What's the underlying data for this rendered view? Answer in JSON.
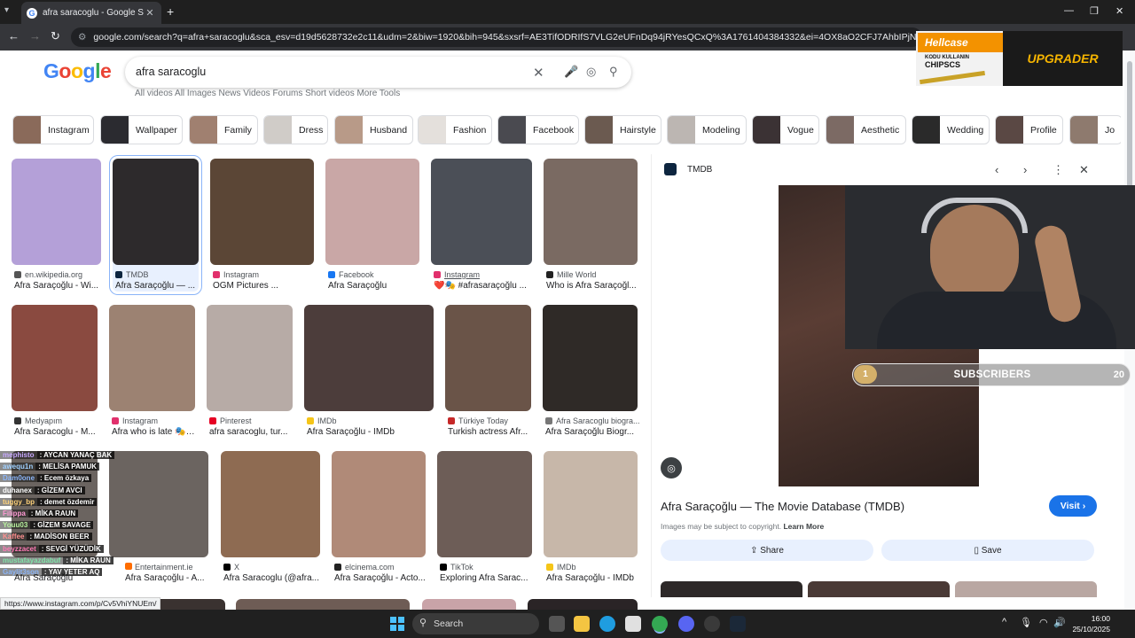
{
  "browser": {
    "tab_title": "afra saracoglu - Google Search",
    "url": "google.com/search?q=afra+saracoglu&sca_esv=d19d5628732e2c11&udm=2&biw=1920&bih=945&sxsrf=AE3TifODRIfS7VLG2eUFnDq94jRYesQCxQ%3A1761404384332&ei=4OX8aO2CFJ7AhbIPjNrtwQw&ved=0ahUKEwjt8ojVz"
  },
  "google": {
    "logo": "Google",
    "query": "afra saracoglu",
    "search_tabs_partial": "All videos   All   Images   News   Videos   Forums   Short videos   More                                                                   Tools"
  },
  "chips": [
    {
      "label": "Instagram"
    },
    {
      "label": "Wallpaper"
    },
    {
      "label": "Family"
    },
    {
      "label": "Dress"
    },
    {
      "label": "Husband"
    },
    {
      "label": "Fashion"
    },
    {
      "label": "Facebook"
    },
    {
      "label": "Hairstyle"
    },
    {
      "label": "Modeling"
    },
    {
      "label": "Vogue"
    },
    {
      "label": "Aesthetic"
    },
    {
      "label": "Wedding"
    },
    {
      "label": "Profile"
    },
    {
      "label": "Jo"
    }
  ],
  "results": [
    {
      "source": "en.wikipedia.org",
      "caption": "Afra Saraçoğlu - Wi...",
      "color": "#b4a0d8",
      "src_color": "#555"
    },
    {
      "source": "TMDB",
      "caption": "Afra Saraçoğlu — ...",
      "color": "#2d2a2c",
      "src_color": "#0d253f"
    },
    {
      "source": "Instagram",
      "caption": "OGM Pictures ...",
      "color": "#5b4636",
      "src_color": "#e1306c"
    },
    {
      "source": "Facebook",
      "caption": "Afra Saraçoğlu",
      "color": "#c9a7a6",
      "src_color": "#1877f2"
    },
    {
      "source": "Instagram",
      "caption": "❤️🎭 #afrasaraçoğlu ...",
      "color": "#4b4f57",
      "src_color": "#e1306c"
    },
    {
      "source": "Mille World",
      "caption": "Who is Afra Saraçoğl...",
      "color": "#7a6a62",
      "src_color": "#222"
    },
    {
      "source": "Medyapım",
      "caption": "Afra Saracoglu - M...",
      "color": "#8a4a40",
      "src_color": "#333"
    },
    {
      "source": "Instagram",
      "caption": "Afra who is late 🎭 ...",
      "color": "#9c8272",
      "src_color": "#e1306c"
    },
    {
      "source": "Pinterest",
      "caption": "afra saracoglu, tur...",
      "color": "#b7aba6",
      "src_color": "#e60023"
    },
    {
      "source": "IMDb",
      "caption": "Afra Saraçoğlu - IMDb",
      "color": "#4c3d3b",
      "src_color": "#f5c518"
    },
    {
      "source": "Türkiye Today",
      "caption": "Turkish actress Afr...",
      "color": "#6a5448",
      "src_color": "#c62828"
    },
    {
      "source": "Afra Saracoglu biogra...",
      "caption": "Afra Saraçoğlu Biogr...",
      "color": "#2f2a27",
      "src_color": "#777"
    },
    {
      "source": "",
      "caption": "Afra Saraçoğlu",
      "color": "#6b6460",
      "src_color": "#1877f2"
    },
    {
      "source": "Entertainment.ie",
      "caption": "Afra Saraçoğlu - A...",
      "color": "#7a5a44",
      "src_color": "#ff6d00"
    },
    {
      "source": "X",
      "caption": "Afra Saracoglu (@afra...",
      "color": "#8e6b52",
      "src_color": "#000"
    },
    {
      "source": "elcinema.com",
      "caption": "Afra Saraçoğlu - Acto...",
      "color": "#b08a78",
      "src_color": "#222"
    },
    {
      "source": "TikTok",
      "caption": "Exploring Afra Sarac...",
      "color": "#6d5d57",
      "src_color": "#000"
    },
    {
      "source": "IMDb",
      "caption": "Afra Saraçoğlu - IMDb",
      "color": "#c7b7a9",
      "src_color": "#f5c518"
    }
  ],
  "panel": {
    "site": "TMDB",
    "title": "Afra Saraçoğlu — The Movie Database (TMDB)",
    "visit_label": "Visit",
    "copyright": "Images may be subject to copyright.",
    "learn_more": "Learn More",
    "share_label": "Share",
    "save_label": "Save"
  },
  "overlay": {
    "hellcase_brand": "Hellcase",
    "hellcase_promo_line1": "KODU KULLANIN",
    "hellcase_promo_line2": "CHIPSCS",
    "hellcase_cta": "UPGRADER",
    "subs_current": "1",
    "subs_label": "SUBSCRIBERS",
    "subs_goal": "20"
  },
  "chat": [
    {
      "user": "mephisto",
      "msg": ": AYCAN YANAÇ BAK"
    },
    {
      "user": "awequ1n",
      "msg": ": MELİSA PAMUK"
    },
    {
      "user": "Dam0one",
      "msg": ": Ecem özkaya"
    },
    {
      "user": "duhanex",
      "msg": ": GİZEM AVCI"
    },
    {
      "user": "tuggy_bp",
      "msg": ": demet özdemir"
    },
    {
      "user": "Filippa",
      "msg": ": MİKA RAUN"
    },
    {
      "user": "Youu03",
      "msg": ": GİZEM SAVAGE"
    },
    {
      "user": "beyzaa",
      "msg": ": SEVGİ YÜZÜDİK"
    },
    {
      "user": "Kaffee",
      "msg": ": MADİSON BEER"
    },
    {
      "user": "beyzzacet",
      "msg": ": SEVGİ YÜZÜDİK"
    },
    {
      "user": "mustafayazdabuf",
      "msg": ": MİKA RAUN"
    },
    {
      "user": "Gaylit3son",
      "msg": ": YAV YETER AQ"
    }
  ],
  "status_url": "https://www.instagram.com/p/Cv5VhiYNUEm/",
  "taskbar": {
    "search_label": "Search",
    "time": "16:00",
    "date": "25/10/2025"
  }
}
